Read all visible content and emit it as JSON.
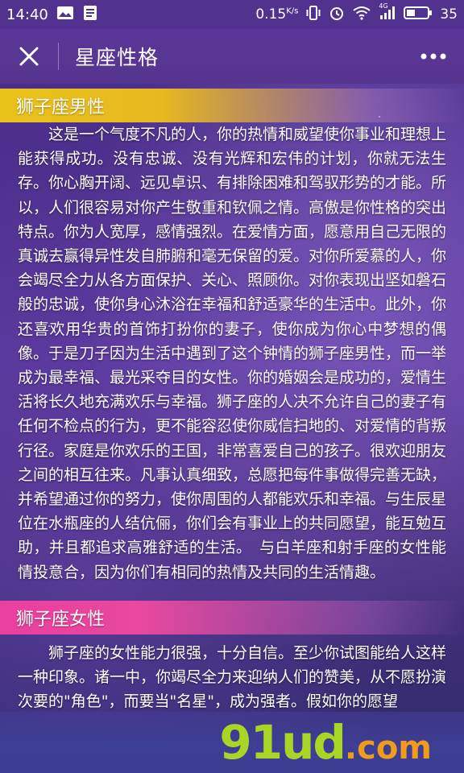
{
  "status_bar": {
    "time": "14:40",
    "speed_value": "0.15",
    "speed_unit": "K/s",
    "network": "4G",
    "battery": "35",
    "icons": [
      "picture-notification-icon",
      "document-notification-icon",
      "vibrate-icon",
      "alarm-icon",
      "wifi-icon",
      "signal-icon",
      "battery-icon"
    ]
  },
  "header": {
    "title": "星座性格",
    "close_icon": "close-icon",
    "more_icon": "more-dots-icon"
  },
  "sections": [
    {
      "heading": "狮子座男性",
      "body": "这是一个气度不凡的人，你的热情和威望使你事业和理想上能获得成功。没有忠诚、没有光辉和宏伟的计划，你就无法生存。你心胸开阔、远见卓识、有排除困难和驾驭形势的才能。所以，人们很容易对你产生敬重和钦佩之情。高傲是你性格的突出特点。你为人宽厚，感情强烈。在爱情方面，愿意用自己无限的真诚去赢得异性发自肺腑和毫无保留的爱。对你所爱慕的人，你会竭尽全力从各方面保护、关心、照顾你。对你表现出坚如磐石般的忠诚，使你身心沐浴在幸福和舒适豪华的生活中。此外，你还喜欢用华贵的首饰打扮你的妻子，使你成为你心中梦想的偶像。于是刀子因为生活中遇到了这个钟情的狮子座男性，而一举成为最幸福、最光采夺目的女性。你的婚姻会是成功的，爱情生活将长久地充满欢乐与幸福。狮子座的人决不允许自己的妻子有任何不检点的行为，更不能容忍使你威信扫地的、对爱情的背叛行径。家庭是你欢乐的王国，非常喜爱自己的孩子。很欢迎朋友之间的相互往来。凡事认真细致，总愿把每件事做得完善无缺，并希望通过你的努力，使你周围的人都能欢乐和幸福。与生辰星位在水瓶座的人结伉俪，你们会有事业上的共同愿望，能互勉互助，并且都追求高雅舒适的生活。　与白羊座和射手座的女性能情投意合，因为你们有相同的热情及共同的生活情趣。"
    },
    {
      "heading": "狮子座女性",
      "body": "狮子座的女性能力很强，十分自信。至少你试图能给人这样一种印象。诸一中，你竭尽全力来迎纳人们的赞美，从不愿扮演次要的\"角色\"，而要当\"名星\"，成为强者。假如你的愿望"
    }
  ],
  "watermark": {
    "main": "91ud",
    "tld": ".com"
  },
  "colors": {
    "male_header": "#e9c21a",
    "female_header": "#ea3fa0",
    "app_bar": "#56358f",
    "watermark_main": "#a8d624",
    "watermark_tld": "#f29a1a"
  }
}
